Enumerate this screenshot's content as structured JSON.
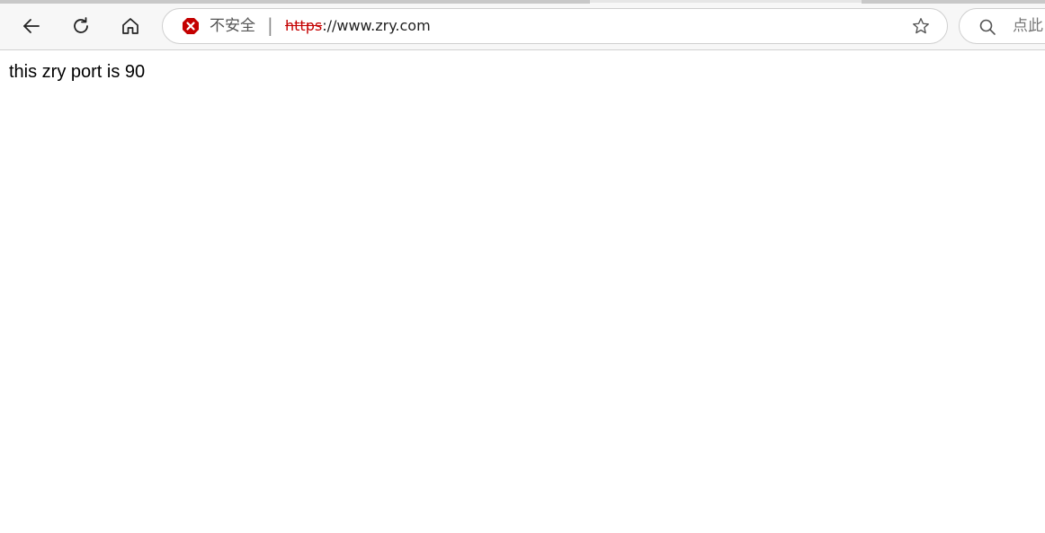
{
  "toolbar": {
    "back_icon": "arrow-left-icon",
    "refresh_icon": "refresh-icon",
    "home_icon": "home-icon"
  },
  "address_bar": {
    "security_icon": "not-secure-x-icon",
    "security_label": "不安全",
    "separator": "|",
    "url_scheme": "https",
    "url_rest": "://www.zry.com",
    "favorite_icon": "star-icon"
  },
  "search": {
    "icon": "search-icon",
    "placeholder": "点此"
  },
  "page": {
    "body_text": "this zry port is 90"
  },
  "colors": {
    "insecure_red": "#c40000",
    "toolbar_bg": "#f7f7f7"
  }
}
